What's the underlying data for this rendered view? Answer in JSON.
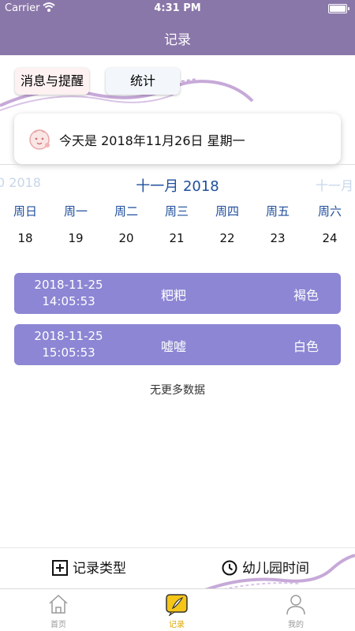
{
  "status_bar": {
    "carrier": "Carrier",
    "time": "4:31 PM"
  },
  "nav": {
    "title": "记录"
  },
  "buttons": {
    "messages": "消息与提醒",
    "stats": "统计"
  },
  "date_card": {
    "text": "今天是 2018年11月26日 星期一",
    "icon": "baby-face-icon"
  },
  "calendar": {
    "prev_month": "0 2018",
    "current_month": "十一月 2018",
    "next_month": "十一月",
    "weekdays": [
      "周日",
      "周一",
      "周二",
      "周三",
      "周四",
      "周五",
      "周六"
    ],
    "days": [
      "18",
      "19",
      "20",
      "21",
      "22",
      "23",
      "24"
    ]
  },
  "records": [
    {
      "date": "2018-11-25",
      "time": "14:05:53",
      "name": "粑粑",
      "color": "褐色"
    },
    {
      "date": "2018-11-25",
      "time": "15:05:53",
      "name": "嘘嘘",
      "color": "白色"
    }
  ],
  "no_more": "无更多数据",
  "actions": {
    "record_types": "记录类型",
    "kindergarten_time": "幼儿园时间"
  },
  "tabs": [
    {
      "label": "首页",
      "icon": "home-icon"
    },
    {
      "label": "记录",
      "icon": "record-icon",
      "active": true
    },
    {
      "label": "我的",
      "icon": "profile-icon"
    }
  ],
  "colors": {
    "nav_bg": "#8a77a9",
    "record_bg": "#8c86d4",
    "calendar_text": "#1f4e9c",
    "active_tab": "#e0a800"
  }
}
